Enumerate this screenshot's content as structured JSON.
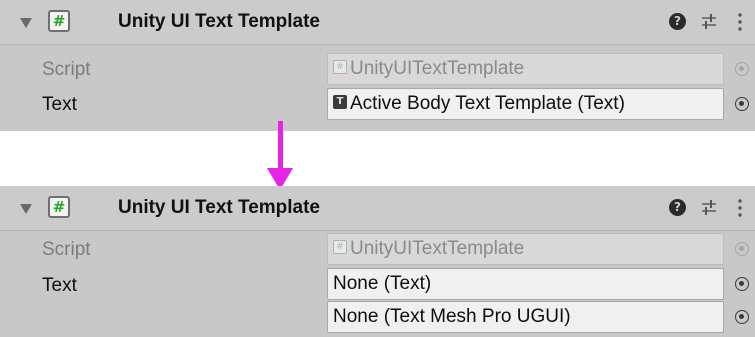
{
  "arrow": {
    "color": "#e823e8"
  },
  "before": {
    "component": {
      "title": "Unity UI Text Template",
      "icon_glyph": "#",
      "help_glyph": "?"
    },
    "script_row": {
      "label": "Script",
      "value": "UnityUITextTemplate",
      "disabled": true
    },
    "text_row": {
      "label": "Text",
      "value": "Active Body Text Template (Text)",
      "icon_glyph": "T"
    }
  },
  "after": {
    "component": {
      "title": "Unity UI Text Template",
      "icon_glyph": "#",
      "help_glyph": "?"
    },
    "script_row": {
      "label": "Script",
      "value": "UnityUITextTemplate",
      "disabled": true
    },
    "text_row": {
      "label": "Text",
      "value": "None (Text)"
    },
    "text_mesh_pro_row": {
      "value": "None (Text Mesh Pro UGUI)"
    }
  },
  "icons": {
    "fold": "triangle-down-icon",
    "script": "csharp-script-icon",
    "help": "help-icon",
    "preset": "preset-sliders-icon",
    "menu": "kebab-menu-icon",
    "picker": "object-picker-icon"
  }
}
